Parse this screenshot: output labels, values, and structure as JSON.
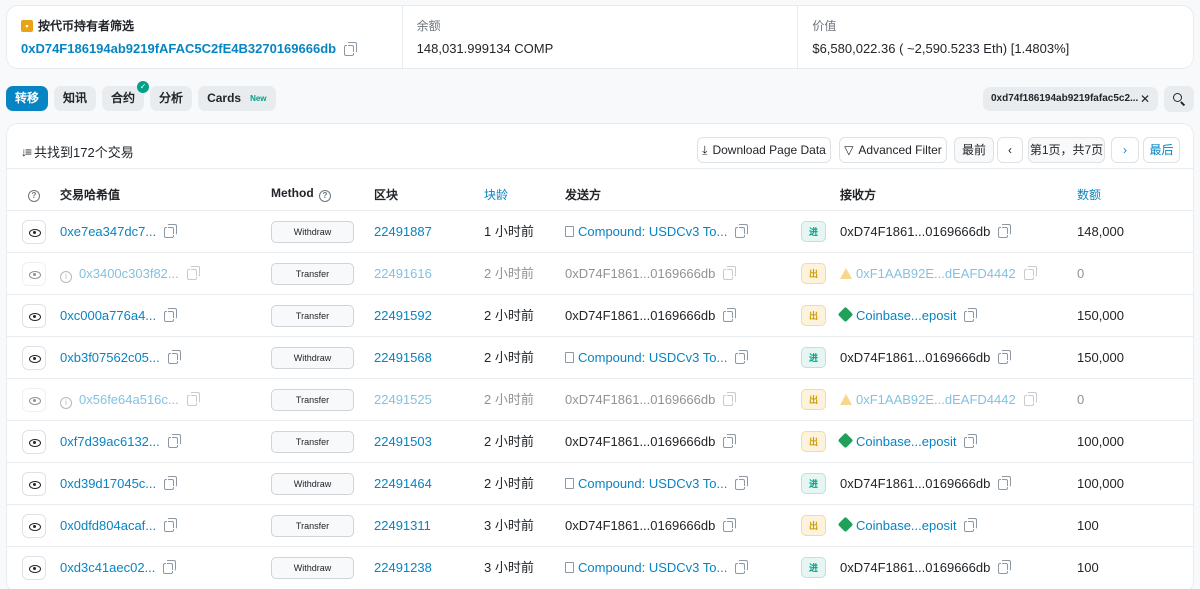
{
  "summary": {
    "filter_label": "按代币持有者筛选",
    "filter_address": "0xD74F186194ab9219fAFAC5C2fE4B3270169666db",
    "balance_label": "余额",
    "balance_value": "148,031.999134 COMP",
    "value_label": "价值",
    "value_value": "$6,580,022.36 ( ~2,590.5233 Eth) [1.4803%]"
  },
  "tabs": [
    {
      "label": "转移",
      "active": true
    },
    {
      "label": "知讯"
    },
    {
      "label": "合约",
      "verified": true
    },
    {
      "label": "分析"
    },
    {
      "label": "Cards",
      "badge": "New"
    }
  ],
  "address_filter": "0xd74f186194ab9219fafac5c2...",
  "table": {
    "found_text": "共找到172个交易",
    "download_label": "Download Page Data",
    "advanced_filter_label": "Advanced Filter",
    "first_label": "最前",
    "page_label": "第1页，共7页",
    "last_label": "最后",
    "headers": {
      "hash": "交易哈希值",
      "method": "Method",
      "block": "区块",
      "age": "块龄",
      "from": "发送方",
      "to": "接收方",
      "amount": "数额"
    },
    "rows": [
      {
        "hash": "0xe7ea347dc7...",
        "method": "Withdraw",
        "block": "22491887",
        "age": "1 小时前",
        "from": "Compound: USDCv3 To...",
        "from_type": "contract",
        "dir": "进",
        "to": "0xD74F1861...0169666db",
        "to_type": "plain",
        "amount": "148,000"
      },
      {
        "hash": "0x3400c303f82...",
        "method": "Transfer",
        "block": "22491616",
        "age": "2 小时前",
        "from": "0xD74F1861...0169666db",
        "from_type": "plain",
        "dir": "出",
        "to": "0xF1AAB92E...dEAFD4442",
        "to_type": "warn",
        "amount": "0",
        "faded": true
      },
      {
        "hash": "0xc000a776a4...",
        "method": "Transfer",
        "block": "22491592",
        "age": "2 小时前",
        "from": "0xD74F1861...0169666db",
        "from_type": "plain",
        "dir": "出",
        "to": "Coinbase...eposit",
        "to_type": "coinbase",
        "amount": "150,000"
      },
      {
        "hash": "0xb3f07562c05...",
        "method": "Withdraw",
        "block": "22491568",
        "age": "2 小时前",
        "from": "Compound: USDCv3 To...",
        "from_type": "contract",
        "dir": "进",
        "to": "0xD74F1861...0169666db",
        "to_type": "plain",
        "amount": "150,000"
      },
      {
        "hash": "0x56fe64a516c...",
        "method": "Transfer",
        "block": "22491525",
        "age": "2 小时前",
        "from": "0xD74F1861...0169666db",
        "from_type": "plain",
        "dir": "出",
        "to": "0xF1AAB92E...dEAFD4442",
        "to_type": "warn",
        "amount": "0",
        "faded": true
      },
      {
        "hash": "0xf7d39ac6132...",
        "method": "Transfer",
        "block": "22491503",
        "age": "2 小时前",
        "from": "0xD74F1861...0169666db",
        "from_type": "plain",
        "dir": "出",
        "to": "Coinbase...eposit",
        "to_type": "coinbase",
        "amount": "100,000"
      },
      {
        "hash": "0xd39d17045c...",
        "method": "Withdraw",
        "block": "22491464",
        "age": "2 小时前",
        "from": "Compound: USDCv3 To...",
        "from_type": "contract",
        "dir": "进",
        "to": "0xD74F1861...0169666db",
        "to_type": "plain",
        "amount": "100,000"
      },
      {
        "hash": "0x0dfd804acaf...",
        "method": "Transfer",
        "block": "22491311",
        "age": "3 小时前",
        "from": "0xD74F1861...0169666db",
        "from_type": "plain",
        "dir": "出",
        "to": "Coinbase...eposit",
        "to_type": "coinbase",
        "amount": "100"
      },
      {
        "hash": "0xd3c41aec02...",
        "method": "Withdraw",
        "block": "22491238",
        "age": "3 小时前",
        "from": "Compound: USDCv3 To...",
        "from_type": "contract",
        "dir": "进",
        "to": "0xD74F1861...0169666db",
        "to_type": "plain",
        "amount": "100"
      }
    ]
  },
  "colors": {
    "link": "#0784c3",
    "in": "#00a186",
    "out": "#cc9a06"
  }
}
